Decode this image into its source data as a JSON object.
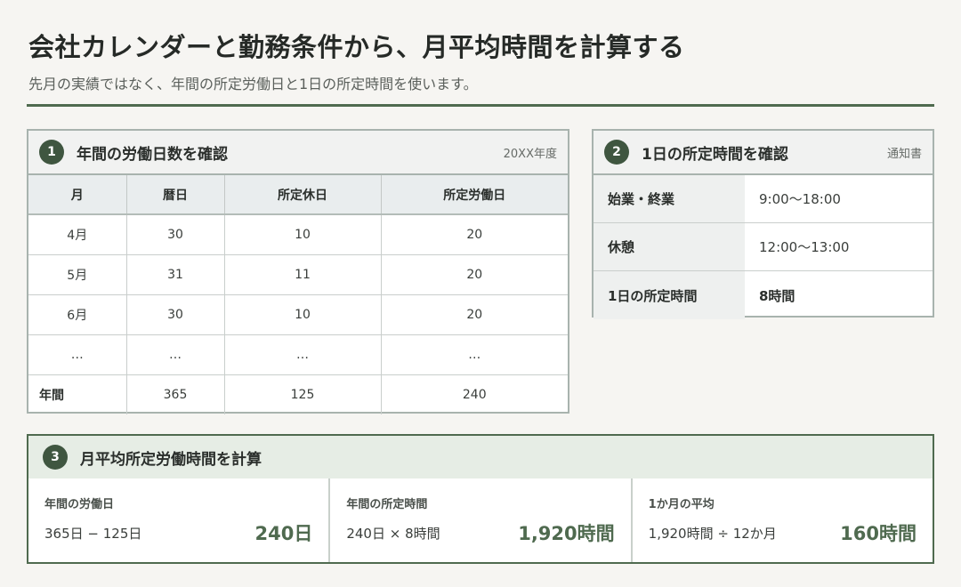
{
  "header": {
    "title": "会社カレンダーと勤務条件から、月平均時間を計算する",
    "subtitle": "先月の実績ではなく、年間の所定労働日と1日の所定時間を使います。"
  },
  "panel1": {
    "number": "1",
    "title": "年間の労働日数を確認",
    "note": "20XX年度",
    "columns": [
      "月",
      "暦日",
      "所定休日",
      "所定労働日"
    ],
    "rows": [
      [
        "4月",
        "30",
        "10",
        "20"
      ],
      [
        "5月",
        "31",
        "11",
        "20"
      ],
      [
        "6月",
        "30",
        "10",
        "20"
      ],
      [
        "…",
        "…",
        "…",
        "…"
      ],
      [
        "年間",
        "365",
        "125",
        "240"
      ]
    ]
  },
  "panel2": {
    "number": "2",
    "title": "1日の所定時間を確認",
    "note": "通知書",
    "rows": [
      {
        "label": "始業・終業",
        "value": "9:00〜18:00"
      },
      {
        "label": "休憩",
        "value": "12:00〜13:00"
      },
      {
        "label": "1日の所定時間",
        "value": "8時間"
      }
    ]
  },
  "panel3": {
    "number": "3",
    "title": "月平均所定労働時間を計算",
    "cells": [
      {
        "label": "年間の労働日",
        "formula": "365日 − 125日",
        "result": "240日"
      },
      {
        "label": "年間の所定時間",
        "formula": "240日 × 8時間",
        "result": "1,920時間"
      },
      {
        "label": "1か月の平均",
        "formula": "1,920時間 ÷ 12か月",
        "result": "160時間"
      }
    ]
  },
  "colors": {
    "accent": "#4f6a4f",
    "badge": "#3f5640",
    "background": "#f6f5f2"
  }
}
